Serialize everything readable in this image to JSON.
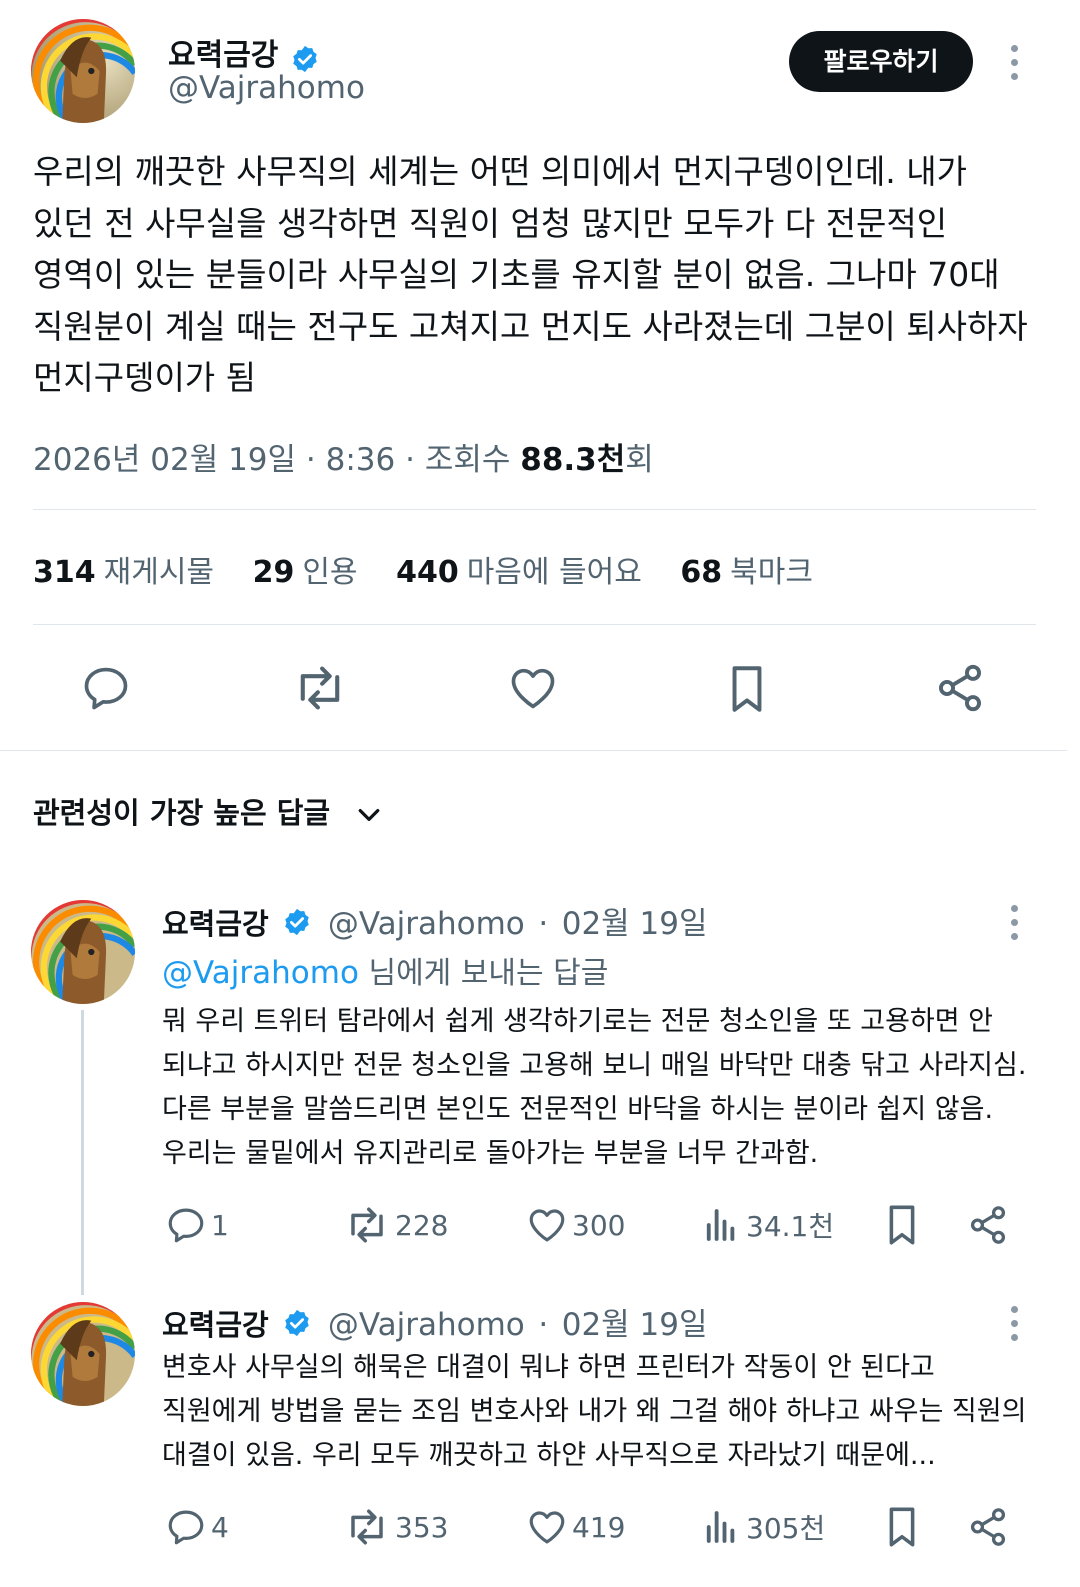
{
  "tweet": {
    "author_name": "요력금강",
    "author_handle": "@Vajrahomo",
    "follow_label": "팔로우하기",
    "text_lines": [
      "우리의 깨끗한 사무직의 세계는 어떤 의미에서 먼지구뎅이인데. 내가",
      "있던 전 사무실을 생각하면 직원이 엄청 많지만 모두가 다 전문적인",
      "영역이 있는 분들이라 사무실의 기초를 유지할 분이 없음. 그나마 70대",
      "직원분이 계실 때는 전구도 고쳐지고 먼지도 사라졌는데 그분이 퇴사하자",
      "먼지구뎅이가 됨"
    ],
    "date": "2026년 02월 19일",
    "time": "8:36",
    "views_label": "조회수",
    "views_count": "88.3천",
    "views_suffix": "회",
    "stats": [
      {
        "num": "314",
        "label": "재게시물"
      },
      {
        "num": "29",
        "label": "인용"
      },
      {
        "num": "440",
        "label": "마음에 들어요"
      },
      {
        "num": "68",
        "label": "북마크"
      }
    ]
  },
  "sort_label": "관련성이 가장 높은 답글",
  "replies": [
    {
      "author_name": "요력금강",
      "author_handle": "@Vajrahomo",
      "date": "02월 19일",
      "reply_to_mention": "@Vajrahomo",
      "reply_to_suffix": " 님에게 보내는 답글",
      "text_lines": [
        "뭐 우리 트위터 탐라에서 쉽게 생각하기로는 전문 청소인을 또 고용하면 안",
        "되냐고 하시지만 전문 청소인을 고용해 보니 매일 바닥만 대충 닦고 사라지심.",
        "다른 부분을 말씀드리면 본인도 전문적인 바닥을 하시는 분이라 쉽지 않음.",
        "우리는 물밑에서 유지관리로  돌아가는 부분을 너무 간과함."
      ],
      "replies_count": "1",
      "reposts_count": "228",
      "likes_count": "300",
      "views_count": "34.1천"
    },
    {
      "author_name": "요력금강",
      "author_handle": "@Vajrahomo",
      "date": "02월 19일",
      "text_lines": [
        "변호사 사무실의 해묵은 대결이 뭐냐 하면 프린터가 작동이 안 된다고",
        "직원에게 방법을 묻는 조임 변호사와 내가 왜 그걸 해야 하냐고 싸우는 직원의",
        "대결이 있음. 우리 모두 깨끗하고 하얀 사무직으로 자라났기 때문에..."
      ],
      "replies_count": "4",
      "reposts_count": "353",
      "likes_count": "419",
      "views_count": "305천"
    }
  ],
  "icons": {
    "verified": "verified-badge-icon",
    "reply": "reply-bubble-icon",
    "repost": "repost-arrows-icon",
    "like": "heart-icon",
    "bookmark": "bookmark-icon",
    "share": "share-nodes-icon",
    "views": "bar-chart-icon",
    "more": "more-vertical-icon",
    "sort": "chevron-down-icon"
  },
  "colors": {
    "text": "#0f1419",
    "secondary": "#536471",
    "accent": "#1d9bf0",
    "follow_button": "#0f1419"
  }
}
